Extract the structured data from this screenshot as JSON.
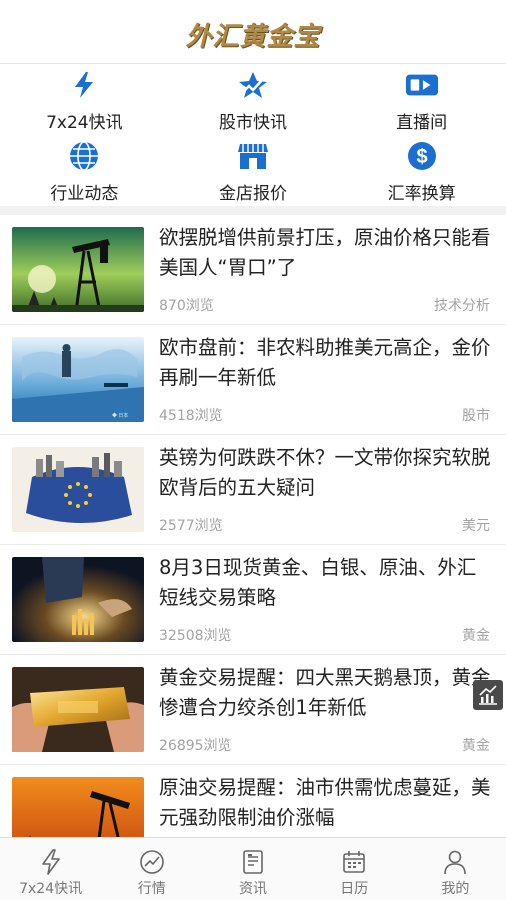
{
  "header": {
    "logo_text": "外汇黄金宝"
  },
  "quick_links": [
    {
      "label": "7x24快讯",
      "icon": "lightning-icon"
    },
    {
      "label": "股市快讯",
      "icon": "stock-star-icon"
    },
    {
      "label": "直播间",
      "icon": "video-camera-icon"
    },
    {
      "label": "行业动态",
      "icon": "globe-icon"
    },
    {
      "label": "金店报价",
      "icon": "store-icon"
    },
    {
      "label": "汇率换算",
      "icon": "dollar-coin-icon"
    }
  ],
  "news": [
    {
      "title": "欲摆脱增供前景打压，原油价格只能看美国人“胃口”了",
      "views": "870浏览",
      "tag": "技术分析",
      "thumb": "oil-pump-sunset"
    },
    {
      "title": "欧市盘前：非农料助推美元高企，金价再刷一年新低",
      "views": "4518浏览",
      "tag": "股市",
      "thumb": "businessman-world-map"
    },
    {
      "title": "英镑为何跌跌不休？一文带你探究软脱欧背后的五大疑问",
      "views": "2577浏览",
      "tag": "美元",
      "thumb": "eu-flag-city"
    },
    {
      "title": "8月3日现货黄金、白银、原油、外汇短线交易策略",
      "views": "32508浏览",
      "tag": "黄金",
      "thumb": "hands-gold-bars"
    },
    {
      "title": "黄金交易提醒：四大黑天鹅悬顶，黄金惨遭合力绞杀创1年新低",
      "views": "26895浏览",
      "tag": "黄金",
      "thumb": "gold-bar-hands"
    },
    {
      "title": "原油交易提醒：油市供需忧虑蔓延，美元强劲限制油价涨幅",
      "views": "",
      "tag": "",
      "thumb": "oil-pump-orange"
    }
  ],
  "tabs": [
    {
      "label": "7x24快讯",
      "icon": "lightning-outline-icon"
    },
    {
      "label": "行情",
      "icon": "chart-circle-icon"
    },
    {
      "label": "资讯",
      "icon": "document-icon"
    },
    {
      "label": "日历",
      "icon": "calendar-icon"
    },
    {
      "label": "我的",
      "icon": "user-icon"
    }
  ],
  "colors": {
    "accent_blue": "#1a6fd1",
    "logo_gold": "#b08a45",
    "tag_gray": "#a3a3a3"
  }
}
